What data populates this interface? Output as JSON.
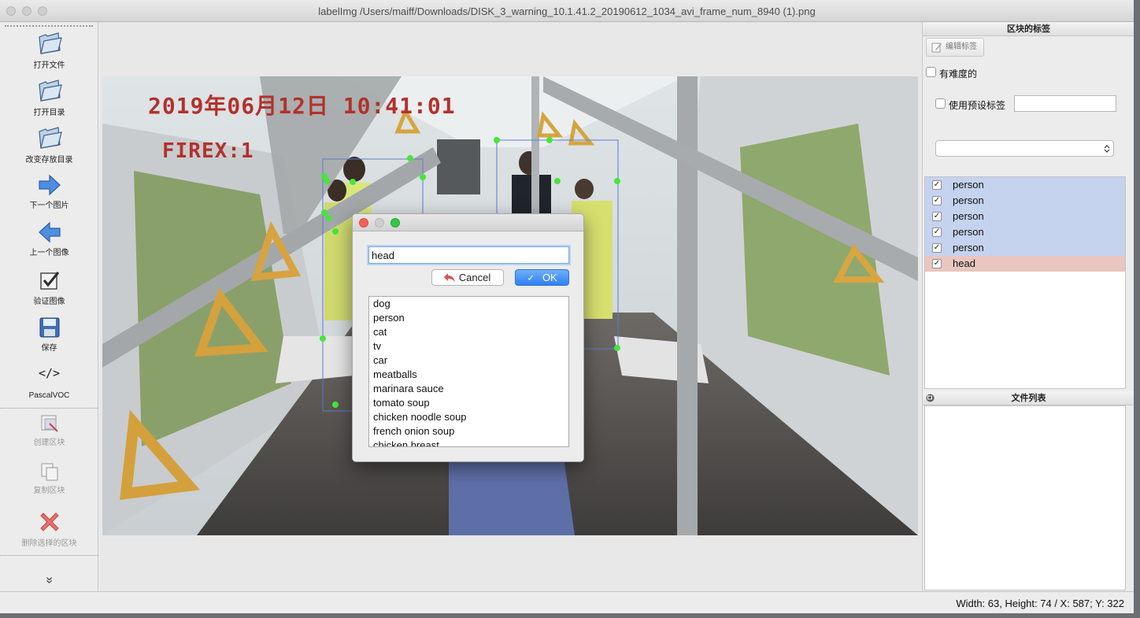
{
  "window": {
    "title": "labelImg /Users/maiff/Downloads/DISK_3_warning_10.1.41.2_20190612_1034_avi_frame_num_8940 (1).png"
  },
  "toolbar": {
    "open_file": "打开文件",
    "open_dir": "打开目录",
    "change_save_dir": "改变存放目录",
    "next_image": "下一个图片",
    "prev_image": "上一个图像",
    "verify_image": "验证图像",
    "save": "保存",
    "format_glyph": "</>",
    "format": "PascalVOC",
    "create_box": "创建区块",
    "duplicate_box": "复制区块",
    "delete_box": "删除选择的区块",
    "more": "»"
  },
  "image_overlay": {
    "timestamp": "2019年06月12日 10:41:01",
    "camera": "FIREX:1"
  },
  "dialog": {
    "input_value": "head",
    "cancel_label": "Cancel",
    "ok_label": "OK",
    "options": [
      "dog",
      "person",
      "cat",
      "tv",
      "car",
      "meatballs",
      "marinara sauce",
      "tomato soup",
      "chicken noodle soup",
      "french onion soup",
      "chicken breast"
    ]
  },
  "right_panel": {
    "box_labels_title": "区块的标签",
    "edit_label_button": "编辑标签",
    "difficult_label": "有难度的",
    "use_default_label": "使用预设标签",
    "labels": [
      {
        "text": "person",
        "checked": true,
        "color": "#c5d3ef"
      },
      {
        "text": "person",
        "checked": true,
        "color": "#c5d3ef"
      },
      {
        "text": "person",
        "checked": true,
        "color": "#c5d3ef"
      },
      {
        "text": "person",
        "checked": true,
        "color": "#c5d3ef"
      },
      {
        "text": "person",
        "checked": true,
        "color": "#c5d3ef"
      },
      {
        "text": "head",
        "checked": true,
        "color": "#e9c7c0"
      }
    ],
    "file_list_title": "文件列表"
  },
  "status": {
    "text": "Width: 63, Height: 74 / X: 587; Y: 322"
  }
}
